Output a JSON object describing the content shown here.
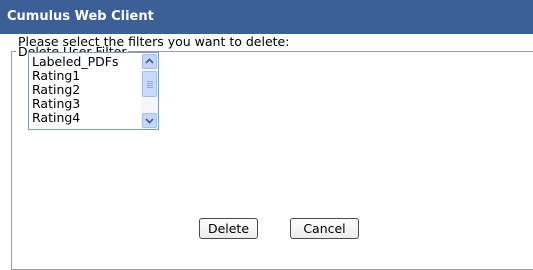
{
  "window": {
    "title": "Cumulus Web Client"
  },
  "dialog": {
    "legend": "Delete User Filter",
    "prompt": "Please select the filters you want to delete:",
    "filters": [
      "Labeled_PDFs",
      "Rating1",
      "Rating2",
      "Rating3",
      "Rating4"
    ],
    "buttons": {
      "delete": "Delete",
      "cancel": "Cancel"
    }
  },
  "icons": {
    "scroll_up": "arrow-up-icon",
    "scroll_down": "arrow-down-icon"
  }
}
